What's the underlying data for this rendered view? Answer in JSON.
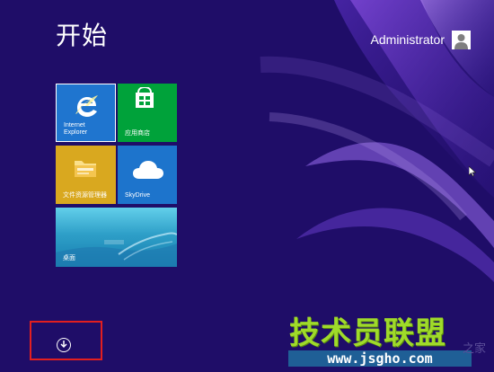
{
  "start_screen": {
    "title": "开始",
    "user_name": "Administrator",
    "background_color": "#1f0d68",
    "tiles": [
      {
        "label": "Internet\nExplorer",
        "icon": "ie-icon",
        "color": "#1f75cf"
      },
      {
        "label": "应用商店",
        "icon": "store-icon",
        "color": "#00a23a"
      },
      {
        "label": "文件资源管理器",
        "icon": "folder-icon",
        "color": "#d9a81f"
      },
      {
        "label": "SkyDrive",
        "icon": "cloud-icon",
        "color": "#1d74cc"
      },
      {
        "label": "桌面",
        "icon": "desktop-preview",
        "color": "#2e9fc8"
      }
    ],
    "apps_button_icon": "down-arrow-icon"
  },
  "watermark": {
    "site_name": "技术员联盟",
    "url": "www.jsgho.com",
    "extra": "之家",
    "color": "#9fda2a"
  }
}
